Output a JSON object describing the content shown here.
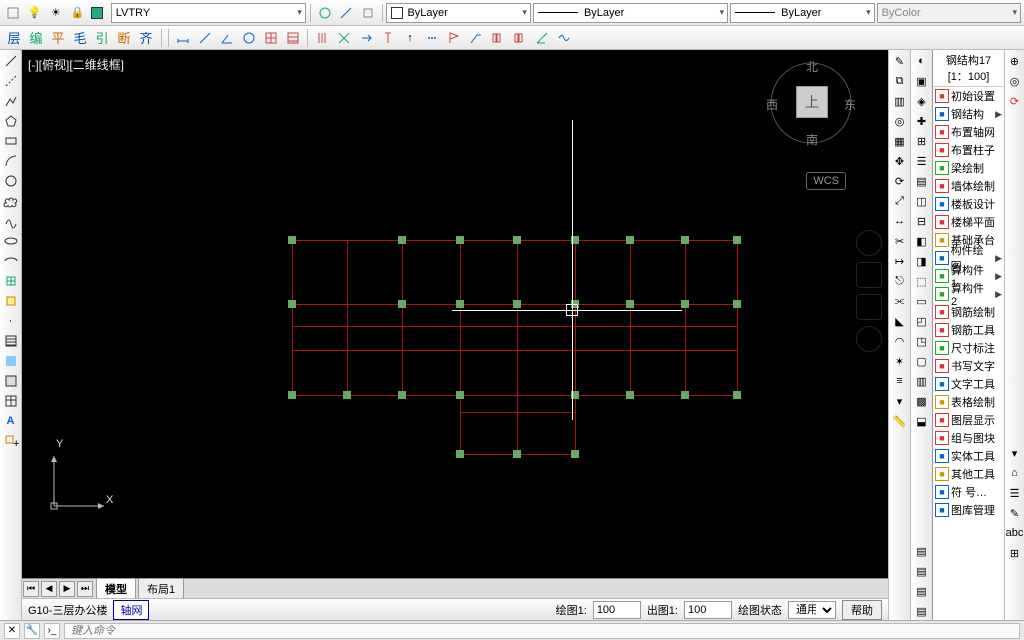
{
  "toolbar": {
    "layer_combo": "LVTRY",
    "prop_color": "ByLayer",
    "prop_linetype": "ByLayer",
    "prop_lineweight": "ByLayer",
    "prop_bycolor": "ByColor"
  },
  "row2": {
    "ch_buttons": [
      "层",
      "编",
      "平",
      "毛",
      "引",
      "断",
      "齐"
    ]
  },
  "viewport": {
    "label": "[-][俯视][二维线框]",
    "wcs": "WCS",
    "compass": {
      "top": "北",
      "right": "东",
      "bottom": "南",
      "left": "西",
      "cube": "上"
    },
    "ucs": {
      "x": "X",
      "y": "Y"
    }
  },
  "tabs": {
    "model": "模型",
    "layout1": "布局1"
  },
  "inner_status": {
    "filename": "G10-三层办公楼",
    "axis_btn": "轴网",
    "scale1_label": "绘图1:",
    "scale1_value": "100",
    "scale2_label": "出图1:",
    "scale2_value": "100",
    "state_label": "绘图状态",
    "state_value": "通用",
    "help": "帮助"
  },
  "right_panel": {
    "title": "钢结构17\n[1：100]",
    "items": [
      {
        "label": "初始设置",
        "k": "r"
      },
      {
        "label": "钢结构",
        "k": "b",
        "arrow": true
      },
      {
        "label": "布置轴网",
        "k": "r"
      },
      {
        "label": "布置柱子",
        "k": "r"
      },
      {
        "label": "梁绘制",
        "k": "g"
      },
      {
        "label": "墙体绘制",
        "k": "r"
      },
      {
        "label": "楼板设计",
        "k": "b"
      },
      {
        "label": "楼梯平面",
        "k": "r"
      },
      {
        "label": "基础承台",
        "k": "y"
      },
      {
        "label": "构件绘图",
        "k": "b",
        "arrow": true
      },
      {
        "label": "算构件 1",
        "k": "g",
        "arrow": true
      },
      {
        "label": "算构件 2",
        "k": "g",
        "arrow": true
      },
      {
        "label": "钢筋绘制",
        "k": "r"
      },
      {
        "label": "钢筋工具",
        "k": "r"
      },
      {
        "label": "尺寸标注",
        "k": "g"
      },
      {
        "label": "书写文字",
        "k": "r"
      },
      {
        "label": "文字工具",
        "k": "b"
      },
      {
        "label": "表格绘制",
        "k": "y"
      },
      {
        "label": "图层显示",
        "k": "r"
      },
      {
        "label": "组与图块",
        "k": "r"
      },
      {
        "label": "实体工具",
        "k": "b"
      },
      {
        "label": "其他工具",
        "k": "y"
      },
      {
        "label": "符 号…",
        "k": "b"
      },
      {
        "label": "图库管理",
        "k": "b"
      }
    ]
  },
  "cmdline": {
    "placeholder": "键入命令"
  }
}
